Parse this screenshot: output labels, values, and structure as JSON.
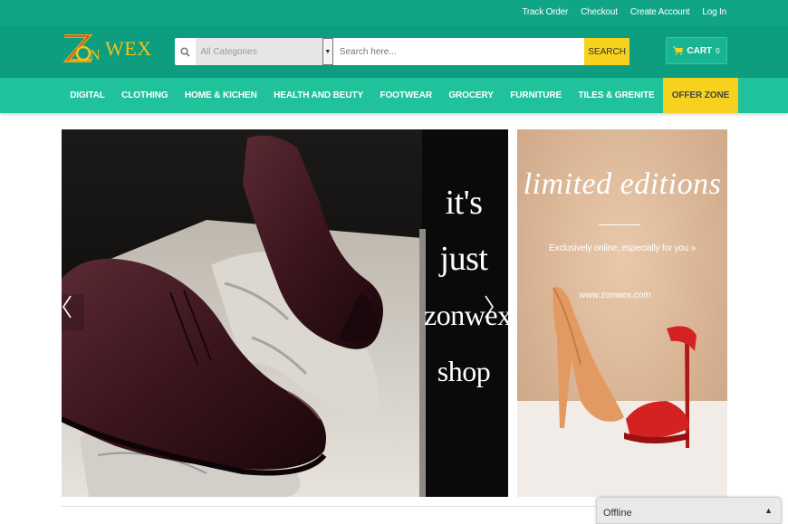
{
  "top_links": [
    "Track Order",
    "Checkout",
    "Create Account",
    "Log In"
  ],
  "logo": {
    "mark": "ZON",
    "text": "WEX"
  },
  "search": {
    "category": "All Categories",
    "placeholder": "Search here...",
    "button": "SEARCH"
  },
  "cart": {
    "label": "CART",
    "count": "0"
  },
  "nav": {
    "items": [
      "DIGITAL",
      "CLOTHING",
      "HOME & KICHEN",
      "HEALTH AND BEUTY",
      "FOOTWEAR",
      "GROCERY",
      "FURNITURE",
      "TILES & GRENITE"
    ],
    "offer": "OFFER ZONE"
  },
  "slider": {
    "lines": [
      "it's",
      "just",
      "zonwex",
      "shop"
    ]
  },
  "banner": {
    "title": "limited editions",
    "subtitle": "Exclusively online, especially for you »",
    "url": "www.zonwex.com"
  },
  "chat": {
    "status": "Offline"
  },
  "colors": {
    "topbar": "#10a585",
    "header": "#0d9e80",
    "nav": "#20c29c",
    "accent_yellow": "#f6d21e"
  }
}
